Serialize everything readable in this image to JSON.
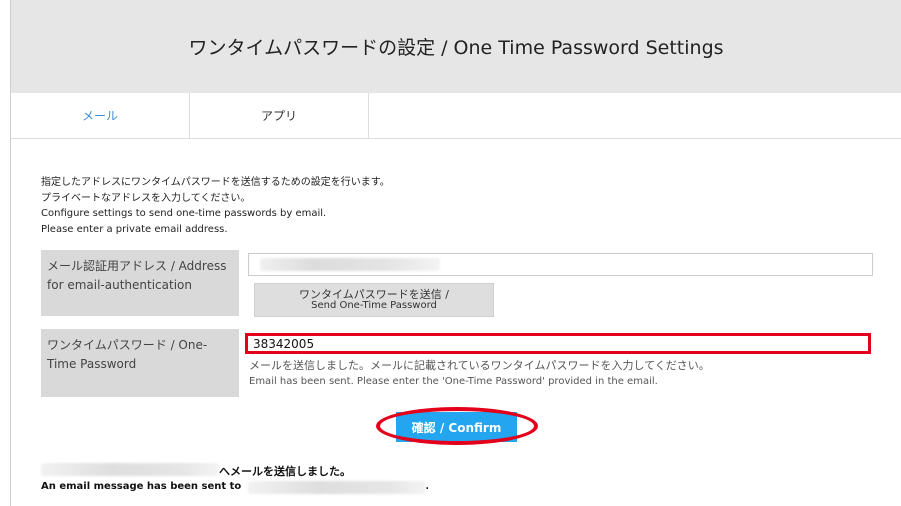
{
  "header": {
    "title": "ワンタイムパスワードの設定 / One Time Password Settings"
  },
  "tabs": [
    {
      "label": "メール",
      "active": true
    },
    {
      "label": "アプリ",
      "active": false
    }
  ],
  "intro": {
    "line1": "指定したアドレスにワンタイムパスワードを送信するための設定を行います。",
    "line2": "プライベートなアドレスを入力してください。",
    "line3": "Configure settings to send one-time passwords by email.",
    "line4": "Please enter a private email address."
  },
  "address": {
    "label": "メール認証用アドレス / Address for email-authentication",
    "send_button_jp": "ワンタイムパスワードを送信 /",
    "send_button_en": "Send One-Time Password"
  },
  "otp": {
    "label": "ワンタイムパスワード / One-Time Password",
    "value": "38342005",
    "message_jp": "メールを送信しました。メールに記載されているワンタイムパスワードを入力してください。",
    "message_en": "Email has been sent. Please enter the 'One-Time Password' provided in the email."
  },
  "confirm": {
    "label": "確認 / Confirm"
  },
  "status": {
    "sent_jp_suffix": "へメールを送信しました。",
    "sent_en_prefix": "An email message has been sent to",
    "sent_en_suffix": "."
  },
  "colors": {
    "accent_blue": "#23a5ef",
    "highlight_red": "#e4001b",
    "tab_active": "#3d8fd8"
  }
}
